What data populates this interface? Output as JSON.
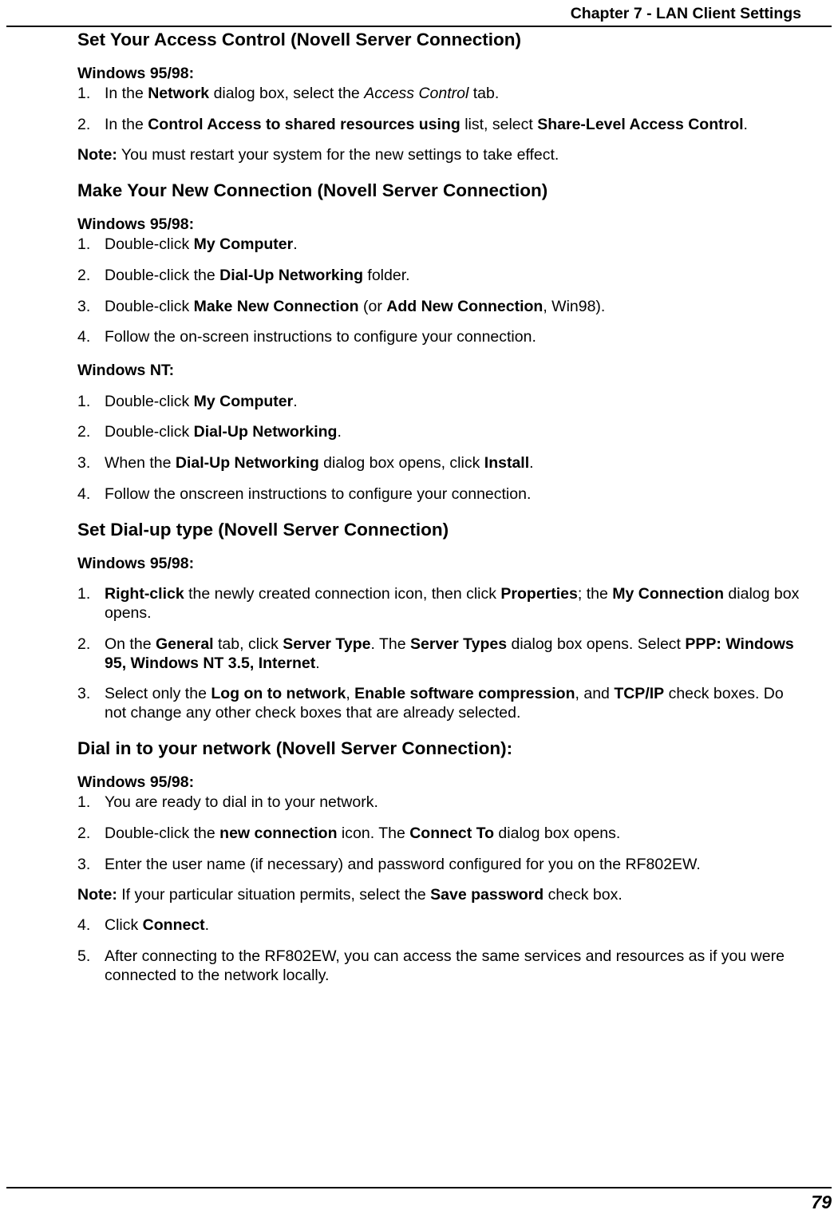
{
  "header": {
    "chapter": "Chapter 7 - LAN Client Settings"
  },
  "s1": {
    "title": "Set Your Access Control (Novell Server Connection)",
    "sub1": "Windows 95/98:",
    "li1_a": "In the ",
    "li1_b": "Network",
    "li1_c": " dialog box, select the ",
    "li1_d": "Access Control",
    "li1_e": " tab.",
    "li2_a": "In the ",
    "li2_b": "Control Access to shared resources using",
    "li2_c": " list, select ",
    "li2_d": "Share-Level Access Control",
    "li2_e": ".",
    "note_a": "Note:",
    "note_b": "  You must restart your system for the new settings to take effect."
  },
  "s2": {
    "title": "Make Your New Connection (Novell Server Connection)",
    "subA": "Windows 95/98:",
    "a1_a": "Double-click ",
    "a1_b": "My Computer",
    "a1_c": ".",
    "a2_a": "Double-click the  ",
    "a2_b": "Dial-Up Networking",
    "a2_c": " folder.",
    "a3_a": "Double-click ",
    "a3_b": "Make New Connection",
    "a3_c": " (or ",
    "a3_d": "Add New Connection",
    "a3_e": ", Win98).",
    "a4": "Follow the on-screen instructions to configure your connection.",
    "subB": "Windows NT:",
    "b1_a": "Double-click ",
    "b1_b": "My Computer",
    "b1_c": ".",
    "b2_a": "Double-click ",
    "b2_b": "Dial-Up Networking",
    "b2_c": ".",
    "b3_a": "When the ",
    "b3_b": "Dial-Up Networking",
    "b3_c": " dialog box opens, click ",
    "b3_d": "Install",
    "b3_e": ".",
    "b4": "Follow the onscreen instructions to configure your connection."
  },
  "s3": {
    "title": "Set Dial-up type (Novell Server Connection)",
    "sub": "Windows 95/98:",
    "l1_a": "Right-click",
    "l1_b": " the newly created connection icon, then click ",
    "l1_c": "Properties",
    "l1_d": "; the ",
    "l1_e": "My Connection",
    "l1_f": " dialog box opens.",
    "l2_a": "On the ",
    "l2_b": "General",
    "l2_c": " tab, click ",
    "l2_d": "Server Type",
    "l2_e": ".  The ",
    "l2_f": "Server Types",
    "l2_g": " dialog box opens. Select ",
    "l2_h": "PPP: Windows 95, Windows NT 3.5, Internet",
    "l2_i": ".",
    "l3_a": "Select only the ",
    "l3_b": "Log on to network",
    "l3_c": ", ",
    "l3_d": "Enable software compression",
    "l3_e": ", and ",
    "l3_f": "TCP/IP",
    "l3_g": " check boxes. Do not change any other check boxes that are already selected."
  },
  "s4": {
    "title": "Dial in to your network (Novell Server Connection):",
    "sub": "Windows 95/98:",
    "l1": "You are ready to dial in to your network.",
    "l2_a": "Double-click the ",
    "l2_b": "new connection",
    "l2_c": " icon.  The ",
    "l2_d": "Connect To",
    "l2_e": " dialog box opens.",
    "l3": "Enter the user name (if necessary) and password configured for you on the RF802EW.",
    "note_a": "Note:",
    "note_b": " If your particular situation permits, select the ",
    "note_c": "Save password",
    "note_d": " check box.",
    "l4_a": "Click ",
    "l4_b": "Connect",
    "l4_c": ".",
    "l5": "After connecting to the RF802EW, you can access the same services and resources as if you were connected to the network locally."
  },
  "footer": {
    "page": "79"
  }
}
